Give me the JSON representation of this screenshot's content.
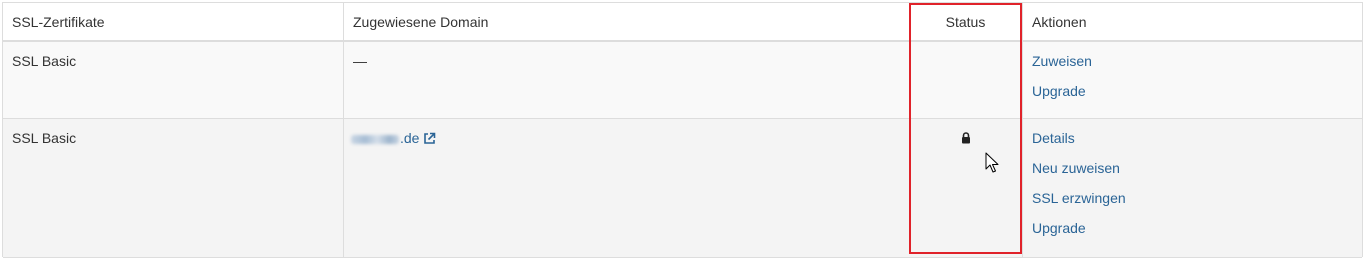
{
  "table": {
    "headers": {
      "certificate": "SSL-Zertifikate",
      "domain": "Zugewiesene Domain",
      "status": "Status",
      "actions": "Aktionen"
    },
    "rows": [
      {
        "certificate": "SSL Basic",
        "domain": "—",
        "status_icon": "none",
        "actions": [
          "Zuweisen",
          "Upgrade"
        ]
      },
      {
        "certificate": "SSL Basic",
        "domain_suffix": ".de",
        "domain_icon": "external-link-icon",
        "status_icon": "lock-icon",
        "actions": [
          "Details",
          "Neu zuweisen",
          "SSL erzwingen",
          "Upgrade"
        ]
      }
    ]
  },
  "colors": {
    "link": "#2a6496",
    "highlight": "#e0222a",
    "border": "#dddddd"
  }
}
